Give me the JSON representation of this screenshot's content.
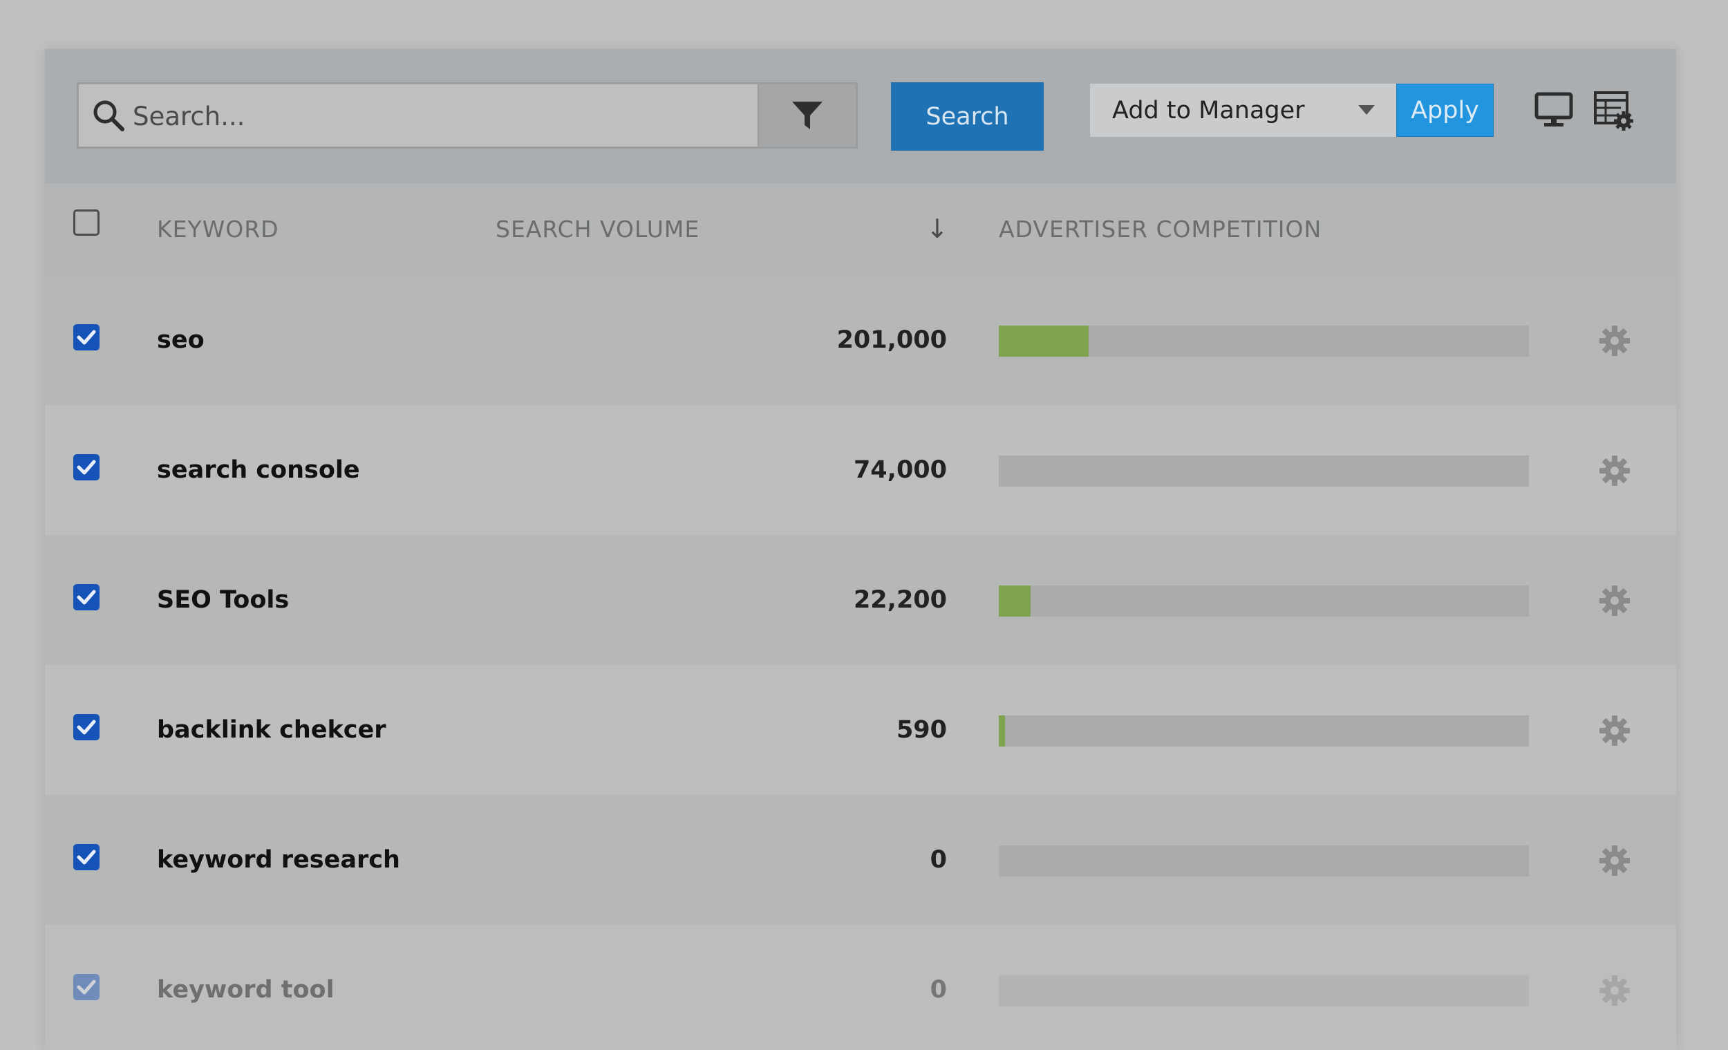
{
  "toolbar": {
    "search_placeholder": "Search...",
    "search_button": "Search",
    "add_to_manager": "Add to Manager",
    "apply_button": "Apply"
  },
  "table": {
    "headers": {
      "keyword": "KEYWORD",
      "search_volume": "SEARCH VOLUME",
      "sort_arrow": "↓",
      "advertiser_competition": "ADVERTISER COMPETITION"
    },
    "rows": [
      {
        "keyword": "seo",
        "volume": "201,000",
        "competition": 0.17,
        "checked": true
      },
      {
        "keyword": "search console",
        "volume": "74,000",
        "competition": 0.0,
        "checked": true
      },
      {
        "keyword": "SEO Tools",
        "volume": "22,200",
        "competition": 0.06,
        "checked": true
      },
      {
        "keyword": "backlink chekcer",
        "volume": "590",
        "competition": 0.012,
        "checked": true
      },
      {
        "keyword": "keyword research",
        "volume": "0",
        "competition": 0.0,
        "checked": true
      },
      {
        "keyword": "keyword tool",
        "volume": "0",
        "competition": 0.0,
        "checked": true
      }
    ]
  },
  "colors": {
    "search_button": "#1f72b3",
    "apply_button": "#2394de",
    "checkbox": "#1553b8",
    "competition_bar": "#80a351"
  },
  "icons": [
    "search-icon",
    "filter-icon",
    "chevron-down-icon",
    "monitor-icon",
    "table-settings-icon",
    "gear-icon",
    "checkmark-icon"
  ]
}
